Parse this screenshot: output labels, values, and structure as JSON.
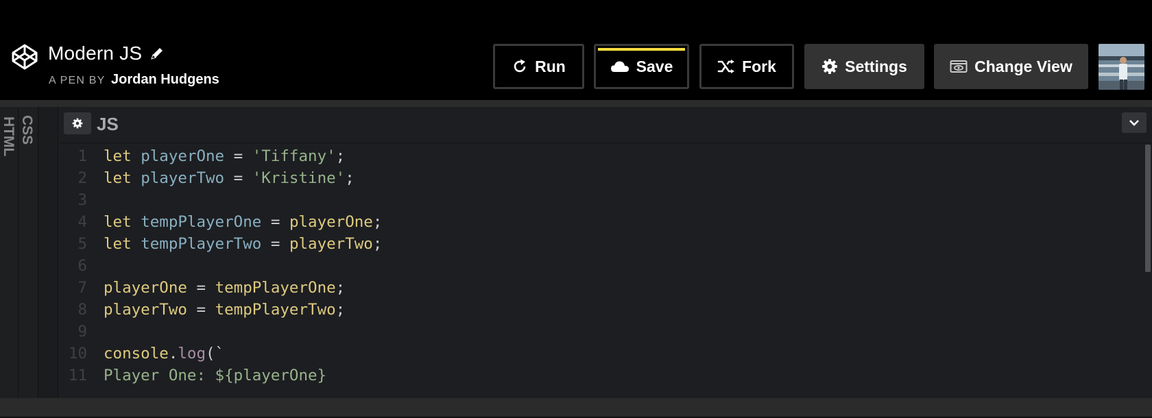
{
  "pen": {
    "title": "Modern JS",
    "by_prefix": "A PEN BY",
    "author": "Jordan Hudgens"
  },
  "toolbar": {
    "run_label": "Run",
    "save_label": "Save",
    "fork_label": "Fork",
    "settings_label": "Settings",
    "change_view_label": "Change View"
  },
  "panels": {
    "html_tab": "HTML",
    "css_tab": "CSS",
    "js_title": "JS"
  },
  "colors": {
    "save_accent": "#ffdd40",
    "keyword": "#ddca7e",
    "variable": "#88afbf",
    "string": "#96b38a"
  },
  "icons": [
    "codepen-logo-icon",
    "pencil-icon",
    "refresh-icon",
    "cloud-icon",
    "fork-icon",
    "gear-icon",
    "eye-icon",
    "chevron-down-icon"
  ],
  "code_lines": [
    {
      "n": "1",
      "tokens": [
        {
          "t": "let",
          "c": "kw"
        },
        {
          "t": " ",
          "c": "op"
        },
        {
          "t": "playerOne",
          "c": "var"
        },
        {
          "t": " = ",
          "c": "op"
        },
        {
          "t": "'Tiffany'",
          "c": "str"
        },
        {
          "t": ";",
          "c": "op"
        }
      ]
    },
    {
      "n": "2",
      "tokens": [
        {
          "t": "let",
          "c": "kw"
        },
        {
          "t": " ",
          "c": "op"
        },
        {
          "t": "playerTwo",
          "c": "var"
        },
        {
          "t": " = ",
          "c": "op"
        },
        {
          "t": "'Kristine'",
          "c": "str"
        },
        {
          "t": ";",
          "c": "op"
        }
      ]
    },
    {
      "n": "3",
      "tokens": []
    },
    {
      "n": "4",
      "tokens": [
        {
          "t": "let",
          "c": "kw"
        },
        {
          "t": " ",
          "c": "op"
        },
        {
          "t": "tempPlayerOne",
          "c": "var"
        },
        {
          "t": " = ",
          "c": "op"
        },
        {
          "t": "playerOne",
          "c": "pl"
        },
        {
          "t": ";",
          "c": "op"
        }
      ]
    },
    {
      "n": "5",
      "tokens": [
        {
          "t": "let",
          "c": "kw"
        },
        {
          "t": " ",
          "c": "op"
        },
        {
          "t": "tempPlayerTwo",
          "c": "var"
        },
        {
          "t": " = ",
          "c": "op"
        },
        {
          "t": "playerTwo",
          "c": "pl"
        },
        {
          "t": ";",
          "c": "op"
        }
      ]
    },
    {
      "n": "6",
      "tokens": []
    },
    {
      "n": "7",
      "tokens": [
        {
          "t": "playerOne",
          "c": "pl"
        },
        {
          "t": " = ",
          "c": "op"
        },
        {
          "t": "tempPlayerOne",
          "c": "pl"
        },
        {
          "t": ";",
          "c": "op"
        }
      ]
    },
    {
      "n": "8",
      "tokens": [
        {
          "t": "playerTwo",
          "c": "pl"
        },
        {
          "t": " = ",
          "c": "op"
        },
        {
          "t": "tempPlayerTwo",
          "c": "pl"
        },
        {
          "t": ";",
          "c": "op"
        }
      ]
    },
    {
      "n": "9",
      "tokens": []
    },
    {
      "n": "10",
      "tokens": [
        {
          "t": "console",
          "c": "pl"
        },
        {
          "t": ".",
          "c": "op"
        },
        {
          "t": "log",
          "c": "fn"
        },
        {
          "t": "(`",
          "c": "op"
        }
      ]
    },
    {
      "n": "11",
      "tokens": [
        {
          "t": "Player One: ${playerOne}",
          "c": "str"
        }
      ]
    }
  ]
}
